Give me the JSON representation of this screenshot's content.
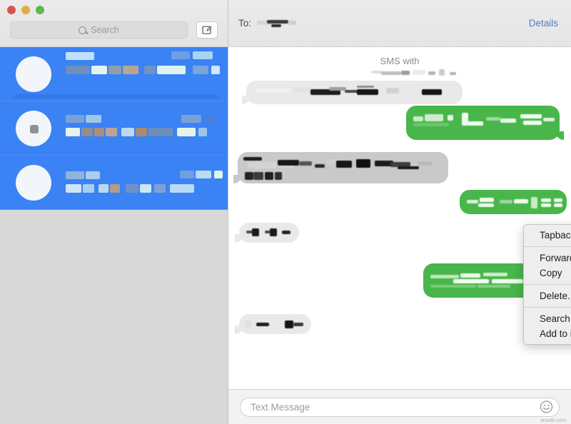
{
  "window": {
    "traffic_lights": [
      {
        "name": "close",
        "color": "#d9544e"
      },
      {
        "name": "minimize",
        "color": "#e0ad47"
      },
      {
        "name": "zoom",
        "color": "#5fba4e"
      }
    ]
  },
  "sidebar": {
    "search": {
      "placeholder": "Search",
      "value": "",
      "icon": "search-icon"
    },
    "compose": {
      "icon": "compose-icon",
      "label": ""
    },
    "conversations": [
      {
        "selected": true,
        "name": "",
        "preview": "",
        "timestamp": ""
      },
      {
        "selected": true,
        "name": "",
        "preview": "",
        "timestamp": ""
      },
      {
        "selected": true,
        "name": "",
        "preview": "",
        "timestamp": ""
      }
    ],
    "selection_color": "#3b82f5",
    "background_color": "#d8d8d8"
  },
  "chat": {
    "header": {
      "to_label": "To:",
      "recipient": "",
      "details_label": "Details",
      "details_color": "#4b7fc4"
    },
    "conversation_title": "SMS with",
    "conversation_name": "",
    "bubble_colors": {
      "incoming": "#e9e9e9",
      "incoming_selected": "#c9c9c9",
      "outgoing": "#48b64a"
    },
    "messages": [
      {
        "id": "m1",
        "side": "incoming",
        "text": "",
        "selected": false
      },
      {
        "id": "m2",
        "side": "outgoing",
        "text": "",
        "selected": false
      },
      {
        "id": "m3",
        "side": "incoming",
        "text": "",
        "selected": true
      },
      {
        "id": "m4",
        "side": "outgoing",
        "text": "",
        "selected": false
      },
      {
        "id": "m5",
        "side": "incoming",
        "text": "",
        "selected": false
      },
      {
        "id": "m6",
        "side": "outgoing",
        "text": "",
        "selected": false
      },
      {
        "id": "m7",
        "side": "incoming",
        "text": "",
        "selected": false
      }
    ]
  },
  "context_menu": {
    "groups": [
      {
        "items": [
          {
            "label": "Tapback..."
          }
        ]
      },
      {
        "items": [
          {
            "label": "Forward..."
          },
          {
            "label": "Copy"
          }
        ]
      },
      {
        "items": [
          {
            "label": "Delete..."
          }
        ]
      },
      {
        "items": [
          {
            "label": "Search With Google"
          },
          {
            "label": "Add to iTunes as a Spoken Track"
          }
        ]
      }
    ]
  },
  "composer": {
    "placeholder": "Text Message",
    "value": "",
    "emoji_button": "smiley-icon"
  },
  "watermark": {
    "text": "wsxdn.com"
  }
}
